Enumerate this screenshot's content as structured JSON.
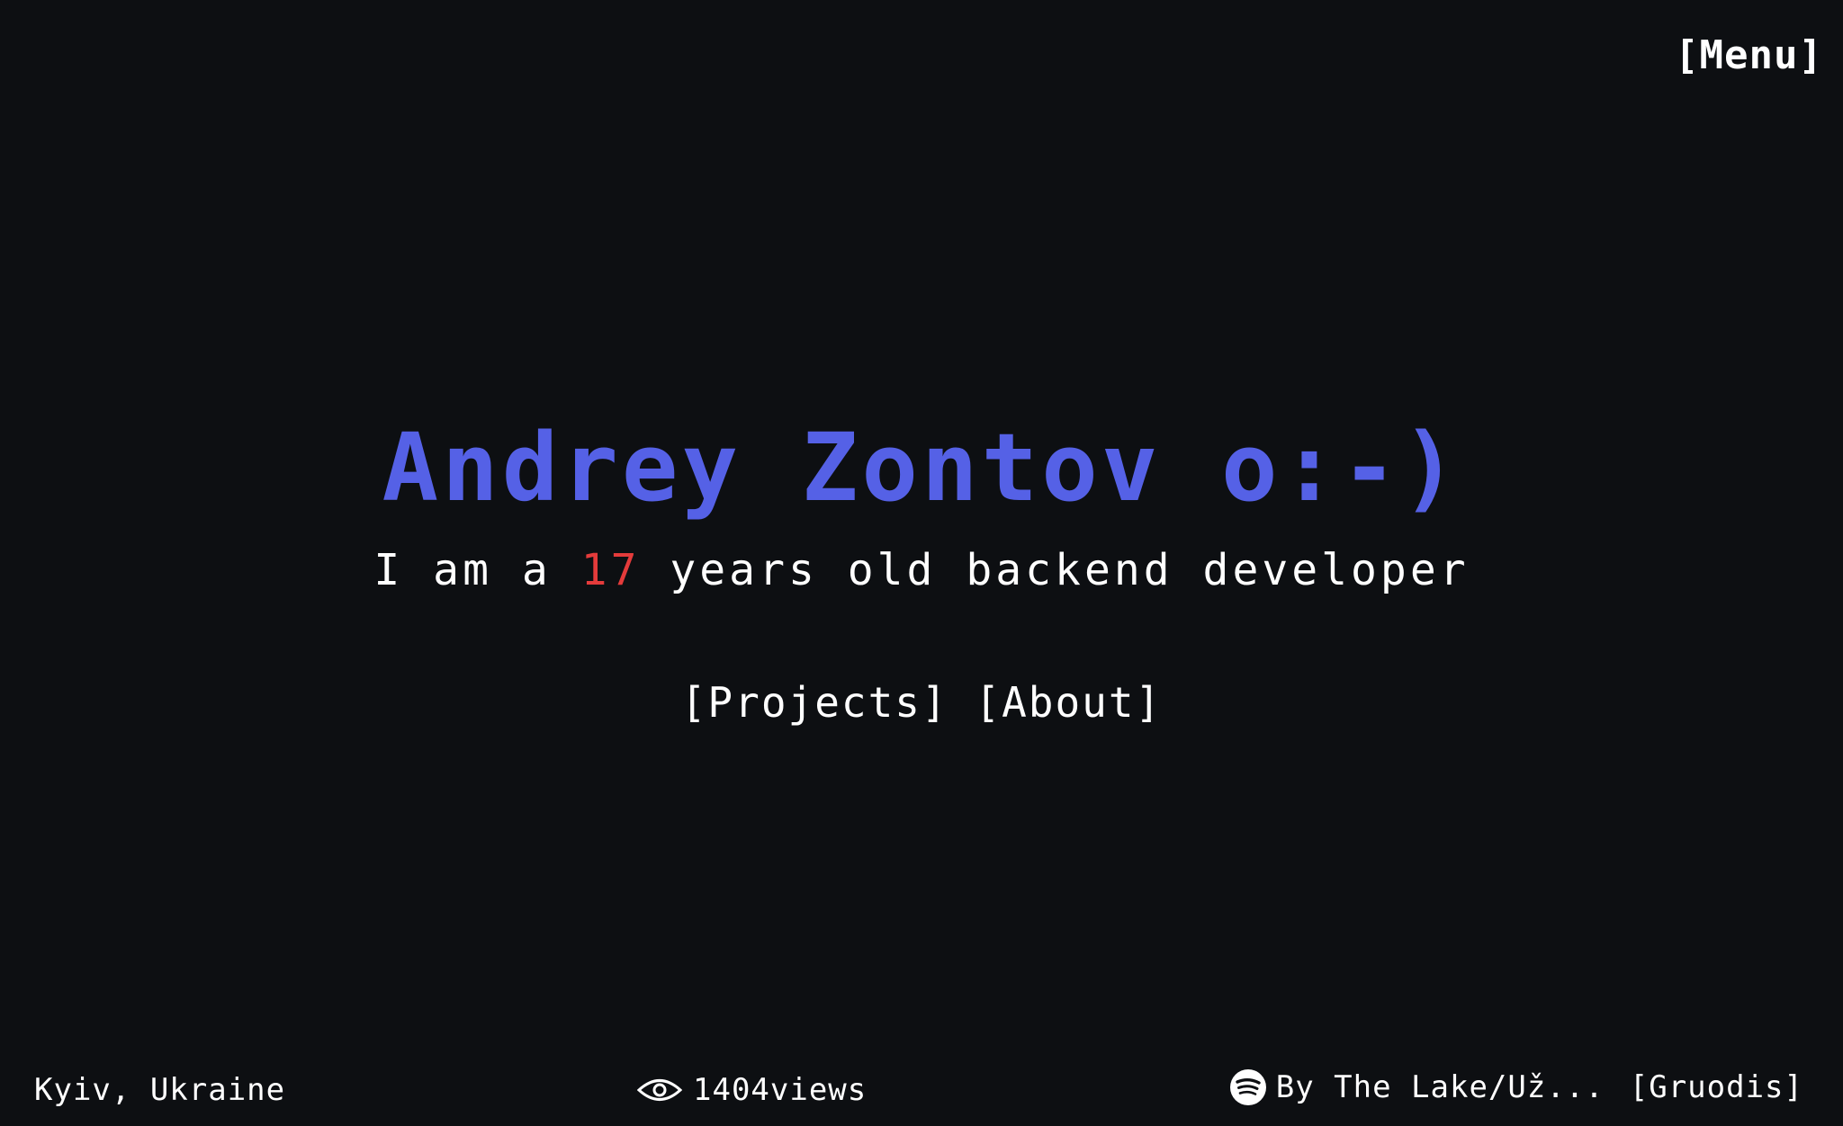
{
  "header": {
    "menu_label": "[Menu]"
  },
  "hero": {
    "title": "Andrey Zontov o:-)",
    "subtitle_prefix": "I am a ",
    "age": "17",
    "subtitle_suffix": " years old backend developer",
    "links": {
      "projects_label": "[Projects]",
      "about_label": "[About]"
    }
  },
  "footer": {
    "location": "Kyiv, Ukraine",
    "views_icon": "eye-icon",
    "views_count": "1404",
    "views_suffix": " views",
    "music_icon": "spotify-icon",
    "track": "By The Lake/Už...",
    "artist": "[Gruodis]"
  },
  "colors": {
    "background": "#0d0f12",
    "title": "#5561e6",
    "accent_age": "#e43b3b",
    "text": "#ffffff"
  }
}
